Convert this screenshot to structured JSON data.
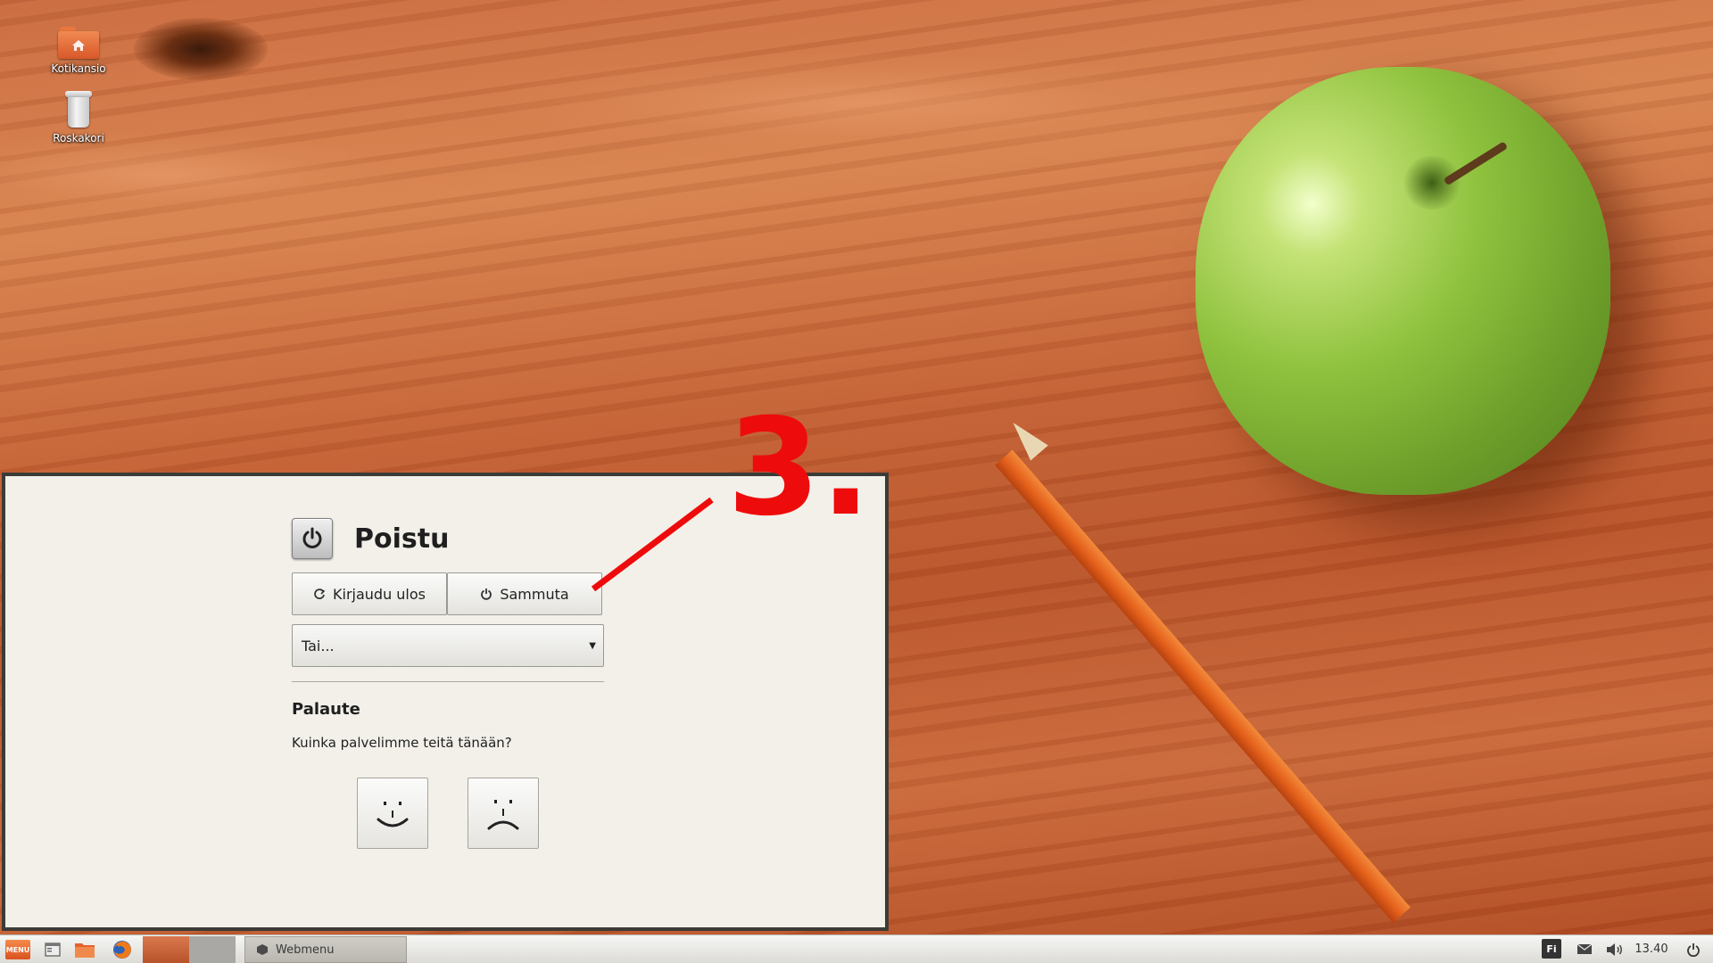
{
  "desktop": {
    "icons": [
      {
        "label": "Kotikansio",
        "icon": "home-folder-icon"
      },
      {
        "label": "Roskakori",
        "icon": "trash-icon"
      }
    ]
  },
  "dialog": {
    "title": "Poistu",
    "title_icon": "power-icon",
    "logout_button": {
      "label": "Kirjaudu ulos",
      "icon": "logout-icon"
    },
    "shutdown_button": {
      "label": "Sammuta",
      "icon": "power-icon"
    },
    "more_select": {
      "value": "Tai...",
      "icon": "dropdown-arrow-icon"
    },
    "feedback": {
      "heading": "Palaute",
      "question": "Kuinka palvelimme teitä tänään?",
      "happy_icon": "happy-face-icon",
      "sad_icon": "sad-face-icon"
    }
  },
  "annotation": {
    "label": "3.",
    "color": "#ee0b0b"
  },
  "taskbar": {
    "menu_label": "MENU",
    "launchers": [
      "show-desktop-icon",
      "file-manager-icon",
      "firefox-icon"
    ],
    "workspaces": 2,
    "task": {
      "label": "Webmenu",
      "icon": "webmenu-icon"
    },
    "tray": {
      "keyboard_layout": "Fi",
      "mail_icon": "mail-icon",
      "volume_icon": "volume-icon",
      "time": "13.40",
      "power_icon": "power-icon"
    }
  },
  "colors": {
    "dialog_background": "#f2f0e9",
    "dialog_border": "#3b3b37",
    "accent_orange": "#e4601b"
  }
}
